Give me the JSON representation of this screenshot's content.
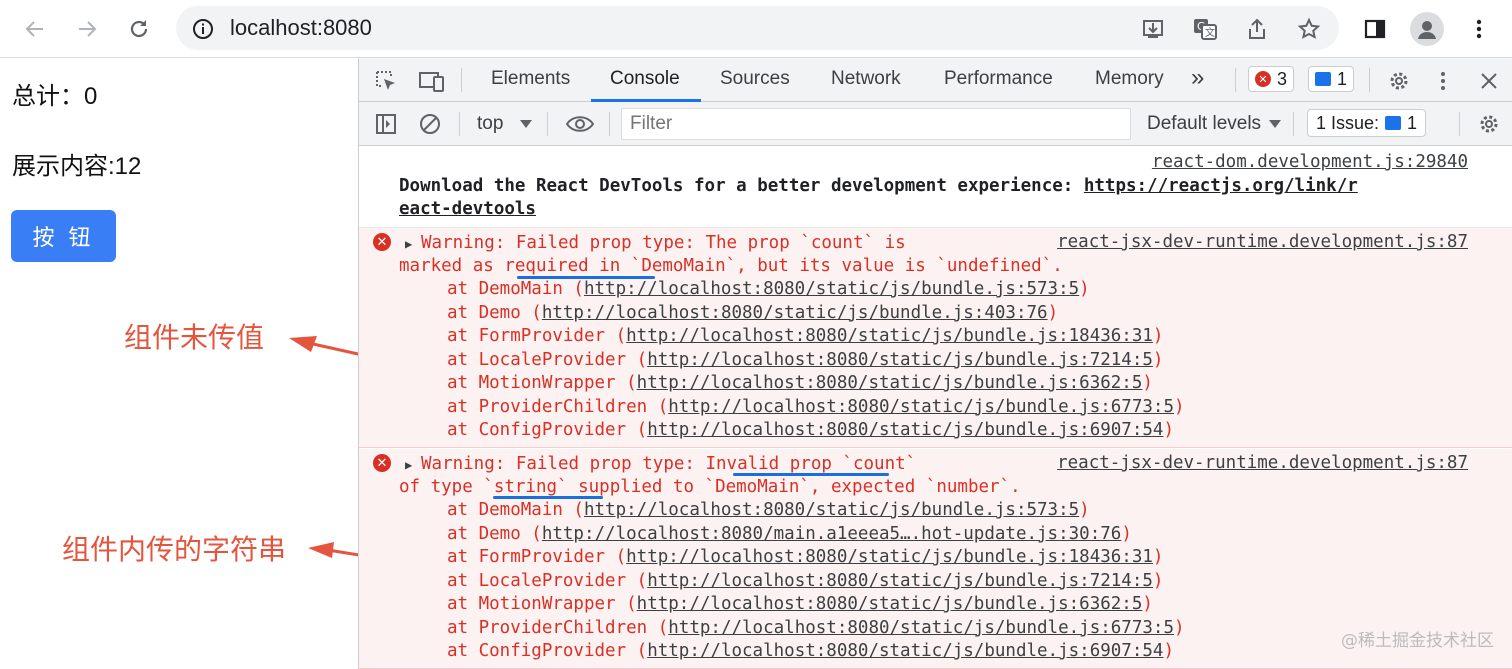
{
  "browser": {
    "url": "localhost:8080",
    "icons": [
      "back-arrow-icon",
      "forward-arrow-icon",
      "reload-icon",
      "site-info-icon",
      "install-icon",
      "translate-icon",
      "share-icon",
      "bookmark-star-icon",
      "side-panel-icon",
      "profile-icon",
      "kebab-menu-icon"
    ]
  },
  "app": {
    "total_label": "总计：0",
    "content_label": "展示内容:12",
    "button_label": "按 钮"
  },
  "annotations": {
    "first": "组件未传值",
    "second": "组件内传的字符串",
    "color": "#e4553e"
  },
  "devtools": {
    "tabs": [
      "Elements",
      "Console",
      "Sources",
      "Network",
      "Performance",
      "Memory"
    ],
    "more_tabs": "»",
    "active_tab": "Console",
    "error_count": "3",
    "message_count": "1",
    "context": "top",
    "filter_placeholder": "Filter",
    "levels": "Default levels",
    "issues_label": "1 Issue:",
    "issues_count": "1"
  },
  "console": {
    "info": {
      "source": "react-dom.development.js:29840",
      "text": "Download the React DevTools for a better development experience: ",
      "link1": "https://reactjs.org/link/r",
      "link2": "eact-devtools"
    },
    "warn1": {
      "source": "react-jsx-dev-runtime.development.js:87",
      "l1": "Warning: Failed prop type: The prop `count` is",
      "l2": "marked as required in `DemoMain`, but its value is `undefined`.",
      "stack": [
        {
          "fn": "at DemoMain (",
          "url": "http://localhost:8080/static/js/bundle.js:573:5",
          "end": ")"
        },
        {
          "fn": "at Demo (",
          "url": "http://localhost:8080/static/js/bundle.js:403:76",
          "end": ")"
        },
        {
          "fn": "at FormProvider (",
          "url": "http://localhost:8080/static/js/bundle.js:18436:31",
          "end": ")"
        },
        {
          "fn": "at LocaleProvider (",
          "url": "http://localhost:8080/static/js/bundle.js:7214:5",
          "end": ")"
        },
        {
          "fn": "at MotionWrapper (",
          "url": "http://localhost:8080/static/js/bundle.js:6362:5",
          "end": ")"
        },
        {
          "fn": "at ProviderChildren (",
          "url": "http://localhost:8080/static/js/bundle.js:6773:5",
          "end": ")"
        },
        {
          "fn": "at ConfigProvider (",
          "url": "http://localhost:8080/static/js/bundle.js:6907:54",
          "end": ")"
        }
      ]
    },
    "warn2": {
      "source": "react-jsx-dev-runtime.development.js:87",
      "l1": "Warning: Failed prop type: Invalid prop `count`",
      "l2": "of type `string` supplied to `DemoMain`, expected `number`.",
      "stack": [
        {
          "fn": "at DemoMain (",
          "url": "http://localhost:8080/static/js/bundle.js:573:5",
          "end": ")"
        },
        {
          "fn": "at Demo (",
          "url": "http://localhost:8080/main.a1eeea5….hot-update.js:30:76",
          "end": ")"
        },
        {
          "fn": "at FormProvider (",
          "url": "http://localhost:8080/static/js/bundle.js:18436:31",
          "end": ")"
        },
        {
          "fn": "at LocaleProvider (",
          "url": "http://localhost:8080/static/js/bundle.js:7214:5",
          "end": ")"
        },
        {
          "fn": "at MotionWrapper (",
          "url": "http://localhost:8080/static/js/bundle.js:6362:5",
          "end": ")"
        },
        {
          "fn": "at ProviderChildren (",
          "url": "http://localhost:8080/static/js/bundle.js:6773:5",
          "end": ")"
        },
        {
          "fn": "at ConfigProvider (",
          "url": "http://localhost:8080/static/js/bundle.js:6907:54",
          "end": ")"
        }
      ]
    }
  },
  "watermark": "@稀土掘金技术社区"
}
